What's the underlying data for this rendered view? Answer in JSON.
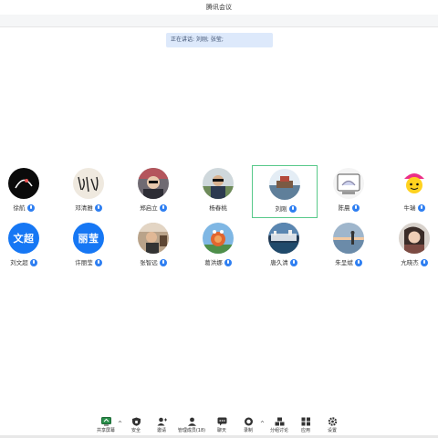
{
  "window": {
    "title": "腾讯会议"
  },
  "speaking": {
    "label": "正在讲话: 刘刚; 张莹;"
  },
  "participants": [
    {
      "name": "徐航",
      "avatar": "dark-photo"
    },
    {
      "name": "邓清雅",
      "avatar": "calligraphy-photo"
    },
    {
      "name": "郑启立",
      "avatar": "portrait-photo"
    },
    {
      "name": "杨春桃",
      "avatar": "outdoor-photo"
    },
    {
      "name": "刘刚",
      "avatar": "landscape-photo"
    },
    {
      "name": "陈晨",
      "avatar": "cartoon-screen"
    },
    {
      "name": "牛瑞",
      "avatar": "cartoon-yellow"
    },
    {
      "name": "刘文超",
      "avatar_text": "文超"
    },
    {
      "name": "许丽莹",
      "avatar_text": "丽莹"
    },
    {
      "name": "张智远",
      "avatar": "room-photo"
    },
    {
      "name": "葛洪娜",
      "avatar": "snail-cartoon"
    },
    {
      "name": "唐久清",
      "avatar": "city-photo"
    },
    {
      "name": "朱呈斌",
      "avatar": "sunset-photo"
    },
    {
      "name": "亢晓杰",
      "avatar": "portrait-photo-2"
    }
  ],
  "toolbar": {
    "share_label": "共享屏幕",
    "security_label": "安全",
    "invite_label": "邀请",
    "members_label": "管理成员(18)",
    "chat_label": "聊天",
    "record_label": "录制",
    "breakout_label": "分组讨论",
    "apps_label": "应用",
    "settings_label": "设置"
  },
  "colors": {
    "accent": "#2f7ff1",
    "active_border": "#58c98a",
    "speaking_bg": "#dde9fb"
  }
}
